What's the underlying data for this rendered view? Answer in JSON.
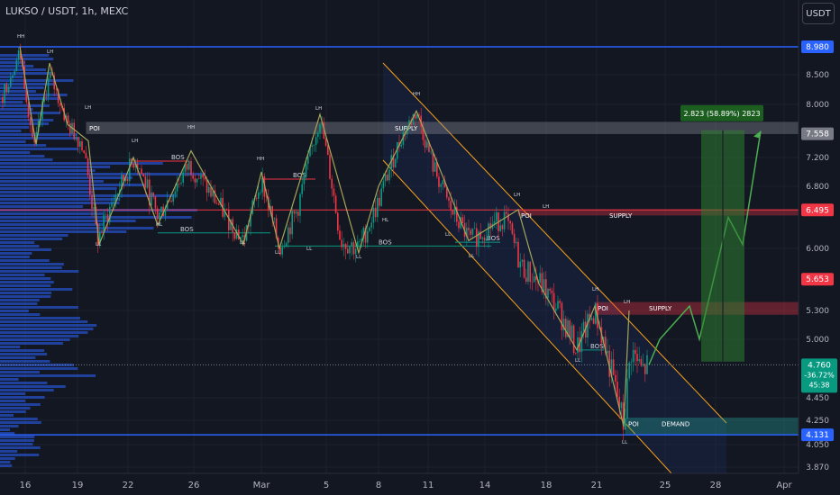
{
  "header": {
    "title": "LUKSO / USDT, 1h, MEXC",
    "currency_button": "USDT"
  },
  "chart_data": {
    "type": "candlestick",
    "symbol": "LUKSO / USDT",
    "interval": "1h",
    "exchange": "MEXC",
    "ylim": [
      3.87,
      9.3
    ],
    "y_ticks": [
      "3.870",
      "4.050",
      "4.250",
      "4.450",
      "5.000",
      "5.300",
      "6.000",
      "6.800",
      "7.200",
      "8.000",
      "8.500"
    ],
    "x_ticks": [
      "16",
      "19",
      "22",
      "26",
      "Mar",
      "5",
      "8",
      "11",
      "14",
      "18",
      "21",
      "25",
      "28",
      "Apr"
    ],
    "price_badges": [
      {
        "value": "8.980",
        "color": "#2962ff"
      },
      {
        "value": "7.558",
        "color": "#787b86"
      },
      {
        "value": "6.495",
        "color": "#f23645"
      },
      {
        "value": "5.653",
        "color": "#f23645"
      },
      {
        "value": "4.131",
        "color": "#2962ff"
      }
    ],
    "last_price": {
      "value": "4.760",
      "change": "-36.72%",
      "countdown": "45:38",
      "color": "#089981"
    },
    "measure": {
      "label": "2.823 (58.89%) 2823",
      "from": 4.79,
      "to": 7.61
    },
    "zones": [
      {
        "label": "POI",
        "label2": "SUPPLY",
        "from": 7.56,
        "to": 7.73,
        "color": "#9598a1"
      },
      {
        "label": "POI",
        "label2": "SUPPLY",
        "from": 6.43,
        "to": 6.5,
        "color": "#f23645"
      },
      {
        "label": "POI",
        "label2": "SUPPLY",
        "from": 5.26,
        "to": 5.39,
        "color": "#f23645"
      },
      {
        "label": "POI",
        "label2": "DEMAND",
        "from": 4.13,
        "to": 4.27,
        "color": "#26a69a"
      }
    ],
    "structure_labels": [
      "HH",
      "LH",
      "LH",
      "HH",
      "LH",
      "HH",
      "LH",
      "HH",
      "LH",
      "LH",
      "LH",
      "LH",
      "LL",
      "LL",
      "HL",
      "LL",
      "LL",
      "HL",
      "LL",
      "LL",
      "LL",
      "LL"
    ],
    "bos_labels": [
      "BOS",
      "BOS",
      "BOS",
      "BOS",
      "BOS",
      "BOS"
    ],
    "projection_path": [
      4.76,
      5.0,
      5.35,
      5.0,
      6.4,
      6.05,
      7.6
    ]
  }
}
